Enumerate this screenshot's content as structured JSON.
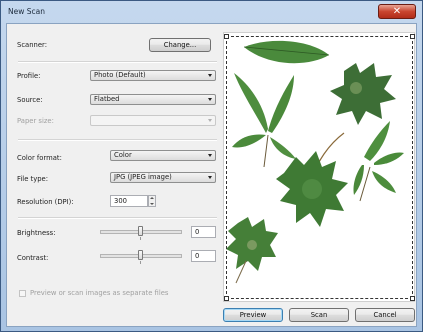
{
  "window": {
    "title": "New Scan",
    "close_icon": "close-icon",
    "accent": "#c9452f"
  },
  "scanner": {
    "label": "Scanner:",
    "change_button": "Change..."
  },
  "profile": {
    "label": "Profile:",
    "value": "Photo (Default)"
  },
  "source": {
    "label": "Source:",
    "value": "Flatbed"
  },
  "paper_size": {
    "label": "Paper size:",
    "value": ""
  },
  "color_format": {
    "label": "Color format:",
    "value": "Color"
  },
  "file_type": {
    "label": "File type:",
    "value": "JPG (JPEG image)"
  },
  "resolution": {
    "label": "Resolution (DPI):",
    "value": "300"
  },
  "brightness": {
    "label": "Brightness:",
    "value": "0",
    "level": 0
  },
  "contrast": {
    "label": "Contrast:",
    "value": "0",
    "level": 0
  },
  "separate_files": {
    "label": "Preview or scan images as separate files",
    "checked": false
  },
  "buttons": {
    "preview": "Preview",
    "scan": "Scan",
    "cancel": "Cancel"
  },
  "preview_image": {
    "subject": "scanned-leaves",
    "leaf_color": "#3f7a34"
  }
}
